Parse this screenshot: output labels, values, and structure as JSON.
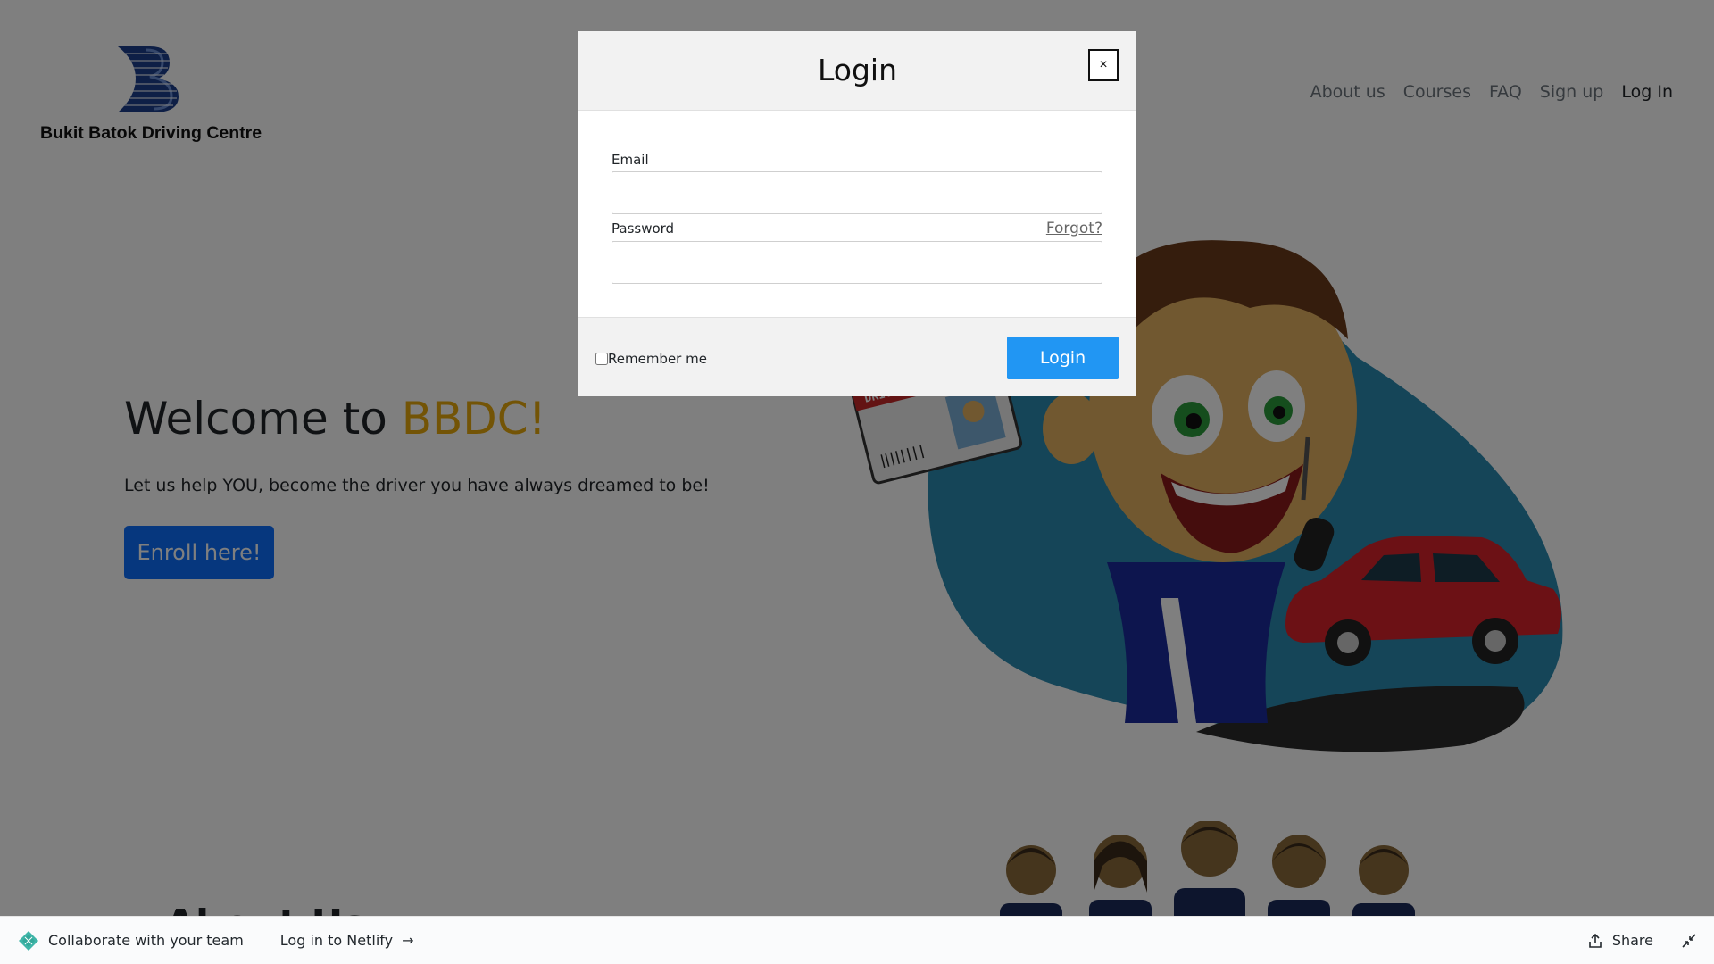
{
  "site": {
    "logo_text": "Bukit Batok Driving Centre",
    "nav": [
      {
        "label": "About us"
      },
      {
        "label": "Courses"
      },
      {
        "label": "FAQ"
      },
      {
        "label": "Sign up"
      },
      {
        "label": "Log In"
      }
    ]
  },
  "hero": {
    "title_prefix": "Welcome to ",
    "title_accent": "BBDC!",
    "subtitle": "Let us help YOU, become the driver you have always dreamed to be!",
    "cta_label": "Enroll here!",
    "illustration_card_title": "DRIVER'S LICENSE"
  },
  "about_peek": "About Us",
  "modal": {
    "title": "Login",
    "close_label": "×",
    "email_label": "Email",
    "email_value": "",
    "password_label": "Password",
    "password_value": "",
    "forgot_label": "Forgot?",
    "remember_label": "Remember me",
    "remember_checked": false,
    "submit_label": "Login"
  },
  "netlify_bar": {
    "collab_label": "Collaborate with your team",
    "login_label": "Log in to Netlify",
    "share_label": "Share"
  },
  "colors": {
    "accent": "#e6a80c",
    "primary": "#0d6efd",
    "login_button": "#2196f3",
    "overlay": "rgba(0,0,0,0.5)"
  }
}
